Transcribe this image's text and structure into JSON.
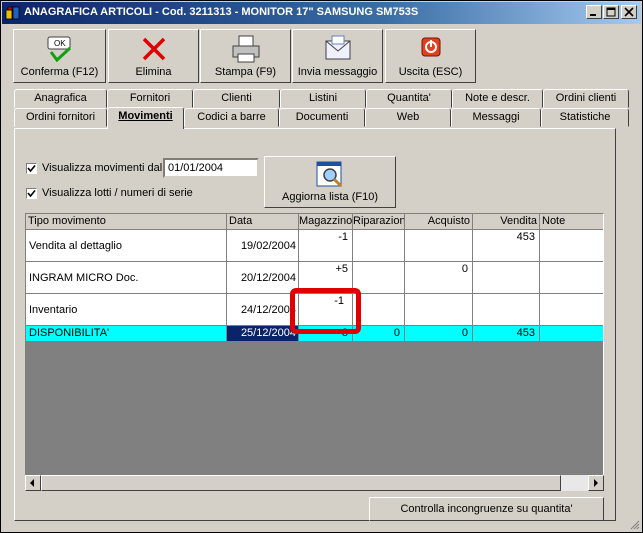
{
  "window": {
    "title": "ANAGRAFICA ARTICOLI - Cod. 3211313 - MONITOR 17\" SAMSUNG SM753S",
    "controls": {
      "minimize": "minimize-icon",
      "maximize": "maximize-icon",
      "close": "close-icon"
    }
  },
  "toolbar": {
    "confirm_label": "Conferma (F12)",
    "confirm_icon_text": "OK",
    "delete_label": "Elimina",
    "print_label": "Stampa (F9)",
    "message_label": "Invia messaggio",
    "exit_label": "Uscita (ESC)"
  },
  "tabs": {
    "row1": [
      "Anagrafica",
      "Fornitori",
      "Clienti",
      "Listini",
      "Quantita'",
      "Note e descr.",
      "Ordini clienti"
    ],
    "row2": [
      "Ordini fornitori",
      "Movimenti",
      "Codici a barre",
      "Documenti",
      "Web",
      "Messaggi",
      "Statistiche"
    ],
    "selected": "Movimenti"
  },
  "filters": {
    "show_movements_label": "Visualizza movimenti dal",
    "show_movements_checked": true,
    "date_from": "01/01/2004",
    "show_lots_label": "Visualizza lotti /  numeri di serie",
    "show_lots_checked": true,
    "refresh_label": "Aggiorna lista (F10)"
  },
  "grid": {
    "columns": [
      "Tipo movimento",
      "Data",
      "Magazzino",
      "Riparazioni",
      "Acquisto",
      "Vendita",
      "Note"
    ],
    "rows": [
      {
        "tipo": "Vendita al dettaglio",
        "data": "19/02/2004",
        "magazzino": "-1",
        "riparazioni": "",
        "acquisto": "",
        "vendita": "453",
        "note": ""
      },
      {
        "tipo": "INGRAM MICRO Doc.",
        "data": "20/12/2004",
        "magazzino": "+5",
        "riparazioni": "",
        "acquisto": "0",
        "vendita": "",
        "note": ""
      },
      {
        "tipo": "Inventario",
        "data": "24/12/2004",
        "magazzino": "-1",
        "riparazioni": "",
        "acquisto": "",
        "vendita": "",
        "note": ""
      },
      {
        "tipo": "DISPONIBILITA'",
        "data": "25/12/2004",
        "magazzino": "3",
        "riparazioni": "0",
        "acquisto": "0",
        "vendita": "453",
        "note": ""
      }
    ]
  },
  "check_button_label": "Controlla incongruenze su quantita'",
  "colors": {
    "highlight_row": "#00ffff",
    "selected_cell": "#0a246a",
    "annotation": "#e00000"
  }
}
